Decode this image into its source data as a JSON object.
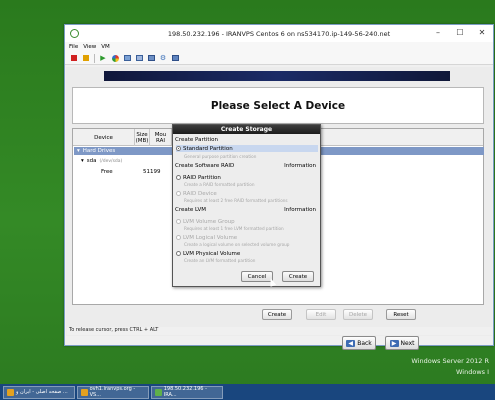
{
  "desktop": {
    "os_label_line1": "Windows Server 2012 R",
    "os_label_line2": "Windows I"
  },
  "vm_window": {
    "title": "198.50.232.196 - IRANVPS Centos 6 on ns534170.ip-149-56-240.net",
    "menu": [
      "File",
      "View",
      "VM"
    ],
    "status_text": "To release cursor, press CTRL + ALT"
  },
  "installer": {
    "heading": "Please Select A Device",
    "columns": {
      "device": "Device",
      "size": "Size\n(MB)",
      "mount": "Mou\nRAI"
    },
    "rows": {
      "group": "Hard Drives",
      "disk": "sda",
      "disk_detail": "(/dev/sda)",
      "free_label": "Free",
      "free_size": "51199"
    },
    "buttons": {
      "create": "Create",
      "edit": "Edit",
      "delete": "Delete",
      "reset": "Reset",
      "back": "Back",
      "next": "Next"
    }
  },
  "dialog": {
    "title": "Create Storage",
    "section_partition": "Create Partition",
    "standard_partition": "Standard Partition",
    "standard_hint": "General purpose partition creation",
    "section_raid": "Create Software RAID",
    "information_label": "Information",
    "raid_partition": "RAID Partition",
    "raid_partition_hint": "Create a RAID formatted partition",
    "raid_device": "RAID Device",
    "raid_device_hint": "Requires at least 2 free RAID formatted partitions",
    "section_lvm": "Create LVM",
    "lvm_volume_group": "LVM Volume Group",
    "lvm_volume_group_hint": "Requires at least 1 free LVM formatted partition",
    "lvm_logical_volume": "LVM Logical Volume",
    "lvm_logical_volume_hint": "Create a logical volume on selected volume group",
    "lvm_physical_volume": "LVM Physical Volume",
    "lvm_physical_volume_hint": "Create an LVM formatted partition",
    "cancel": "Cancel",
    "create": "Create"
  },
  "taskbar": {
    "items": [
      {
        "label": "صفحه اصلی - ایران و ..."
      },
      {
        "label": "ovh1.iranvps.org - VS..."
      },
      {
        "label": "198.50.232.196 - IRA..."
      }
    ]
  },
  "colors": {
    "desktop_green": "#2f7d21",
    "selection_blue": "#7e98c6",
    "taskbar_blue": "#19467e"
  }
}
